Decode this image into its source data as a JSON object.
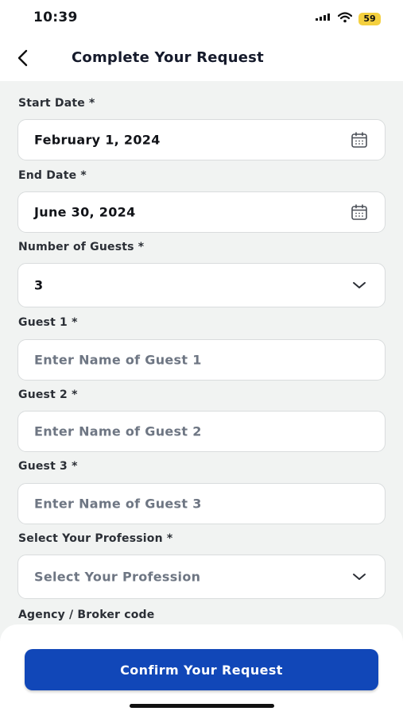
{
  "status_bar": {
    "time": "10:39",
    "battery": "59"
  },
  "header": {
    "title": "Complete Your Request"
  },
  "form": {
    "start_date": {
      "label": "Start Date *",
      "value": "February 1, 2024"
    },
    "end_date": {
      "label": "End Date *",
      "value": "June 30, 2024"
    },
    "guests": {
      "label": "Number of Guests *",
      "value": "3"
    },
    "guest1": {
      "label": "Guest 1 *",
      "placeholder": "Enter Name of Guest 1"
    },
    "guest2": {
      "label": "Guest 2 *",
      "placeholder": "Enter Name of Guest 2"
    },
    "guest3": {
      "label": "Guest 3 *",
      "placeholder": "Enter Name of Guest 3"
    },
    "profession": {
      "label": "Select Your Profession *",
      "placeholder": "Select Your Profession"
    },
    "agency": {
      "label": "Agency / Broker code"
    }
  },
  "actions": {
    "confirm_label": "Confirm Your Request"
  },
  "icons": {
    "back": "chevron-left-icon",
    "calendar": "calendar-icon",
    "dropdown": "chevron-down-icon",
    "signal": "signal-icon",
    "wifi": "wifi-icon",
    "battery": "battery-icon"
  },
  "colors": {
    "accent": "#1147b8",
    "background": "#f1f3f2",
    "field_bg": "#ffffff",
    "placeholder": "#6e7683",
    "battery": "#f4d03f"
  }
}
